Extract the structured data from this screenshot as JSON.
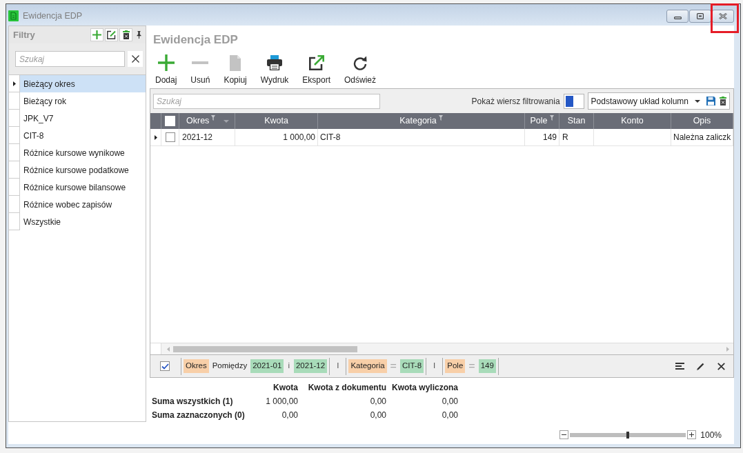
{
  "window": {
    "title": "Ewidencja EDP"
  },
  "filter_panel": {
    "title": "Filtry",
    "search": {
      "placeholder": "Szukaj"
    },
    "items": [
      {
        "label": "Bieżący okres",
        "selected": true
      },
      {
        "label": "Bieżący rok",
        "selected": false
      },
      {
        "label": "JPK_V7",
        "selected": false
      },
      {
        "label": "CIT-8",
        "selected": false
      },
      {
        "label": "Różnice kursowe wynikowe",
        "selected": false
      },
      {
        "label": "Różnice kursowe podatkowe",
        "selected": false
      },
      {
        "label": "Różnice kursowe bilansowe",
        "selected": false
      },
      {
        "label": "Różnice wobec zapisów",
        "selected": false
      },
      {
        "label": "Wszystkie",
        "selected": false
      }
    ]
  },
  "page_title": "Ewidencja EDP",
  "toolbar": [
    {
      "label": "Dodaj",
      "kind": "add",
      "disabled": false
    },
    {
      "label": "Usuń",
      "kind": "remove",
      "disabled": true
    },
    {
      "label": "Kopiuj",
      "kind": "copy",
      "disabled": true
    },
    {
      "label": "Wydruk",
      "kind": "print",
      "disabled": false
    },
    {
      "label": "Eksport",
      "kind": "export",
      "disabled": false
    },
    {
      "label": "Odśwież",
      "kind": "refresh",
      "disabled": false
    }
  ],
  "grid": {
    "search": {
      "placeholder": "Szukaj"
    },
    "filter_row_toggle": {
      "label": "Pokaż wiersz filtrowania",
      "on": false
    },
    "column_layout": {
      "value": "Podstawowy układ kolumn"
    },
    "select_all": {
      "checked": false
    },
    "columns": [
      {
        "label": "Okres",
        "filtered": true,
        "sorted": true
      },
      {
        "label": "Kwota",
        "filtered": false,
        "sorted": false
      },
      {
        "label": "Kategoria",
        "filtered": true,
        "sorted": false
      },
      {
        "label": "Pole",
        "filtered": true,
        "sorted": false
      },
      {
        "label": "Stan",
        "filtered": false,
        "sorted": false
      },
      {
        "label": "Konto",
        "filtered": false,
        "sorted": false
      },
      {
        "label": "Opis",
        "filtered": false,
        "sorted": false
      }
    ],
    "rows": [
      {
        "current": true,
        "checked": false,
        "cells": [
          "2021-12",
          "1 000,00",
          "CIT-8",
          "149",
          "R",
          null,
          "Należna zaliczk"
        ]
      }
    ]
  },
  "filter_bar": {
    "enabled": true,
    "items": [
      {
        "kind": "condition",
        "field": "Okres",
        "operator": {
          "text": "Pomiędzy",
          "kind": "word"
        },
        "values": [
          "2021-01",
          "2021-12"
        ],
        "joiner": "i"
      },
      {
        "kind": "connector",
        "text": "I"
      },
      {
        "kind": "condition",
        "field": "Kategoria",
        "operator": {
          "text": "=",
          "kind": "symbol"
        },
        "values": [
          "CIT-8"
        ]
      },
      {
        "kind": "connector",
        "text": "I"
      },
      {
        "kind": "condition",
        "field": "Pole",
        "operator": {
          "text": "=",
          "kind": "symbol"
        },
        "values": [
          "149"
        ]
      }
    ]
  },
  "summary": {
    "columns": [
      "Kwota",
      "Kwota z dokumentu",
      "Kwota wyliczona"
    ],
    "rows": [
      {
        "label": "Suma wszystkich (1)",
        "values": [
          "1 000,00",
          "0,00",
          "0,00"
        ]
      },
      {
        "label": "Suma zaznaczonych (0)",
        "values": [
          "0,00",
          "0,00",
          "0,00"
        ]
      }
    ]
  },
  "zoom": {
    "level": 0.5,
    "reading": "100%"
  }
}
